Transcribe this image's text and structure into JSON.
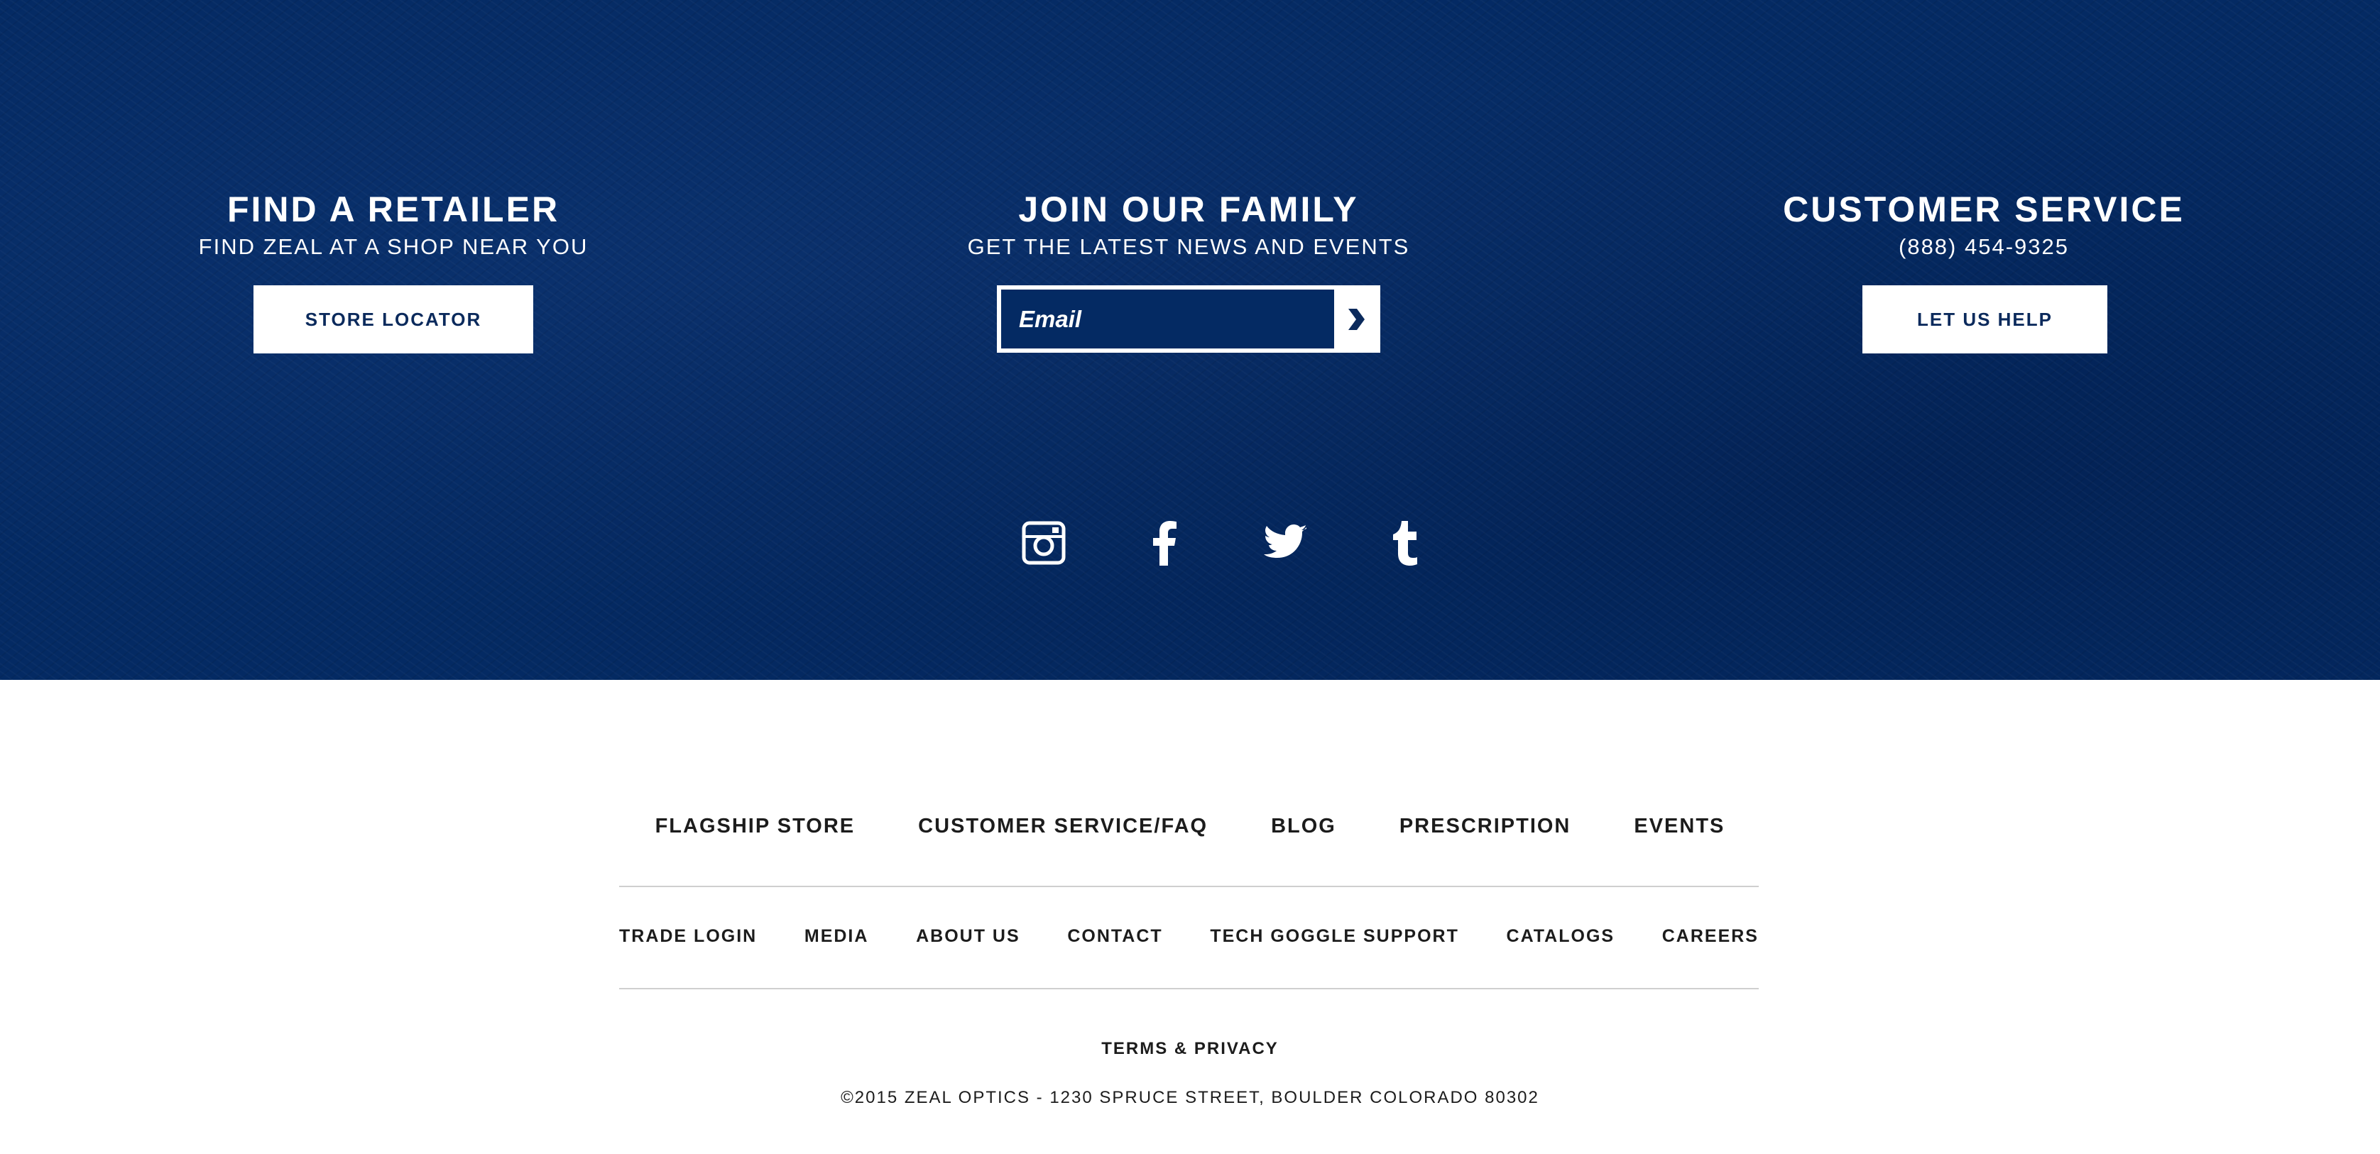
{
  "colors": {
    "band": "#042a63",
    "button_text": "#0b2a5c",
    "footer_text": "#1c1c1c",
    "rule": "#cfcfcf"
  },
  "retailer": {
    "title": "FIND A RETAILER",
    "subtitle": "FIND ZEAL AT A SHOP NEAR YOU",
    "button_label": "STORE LOCATOR"
  },
  "family": {
    "title": "JOIN OUR FAMILY",
    "subtitle": "GET THE LATEST NEWS AND EVENTS",
    "email_placeholder": "Email",
    "submit_icon": "chevron-right-icon"
  },
  "service": {
    "title": "CUSTOMER SERVICE",
    "phone": "(888) 454-9325",
    "button_label": "LET US HELP"
  },
  "social": [
    "instagram-icon",
    "facebook-icon",
    "twitter-icon",
    "tumblr-icon"
  ],
  "primary_nav": [
    "FLAGSHIP STORE",
    "CUSTOMER SERVICE/FAQ",
    "BLOG",
    "PRESCRIPTION",
    "EVENTS"
  ],
  "secondary_nav": [
    "TRADE LOGIN",
    "MEDIA",
    "ABOUT US",
    "CONTACT",
    "TECH GOGGLE SUPPORT",
    "CATALOGS",
    "CAREERS"
  ],
  "legal": {
    "terms": "TERMS & PRIVACY",
    "copyright": "©2015 ZEAL OPTICS - 1230 SPRUCE STREET, BOULDER COLORADO 80302"
  }
}
